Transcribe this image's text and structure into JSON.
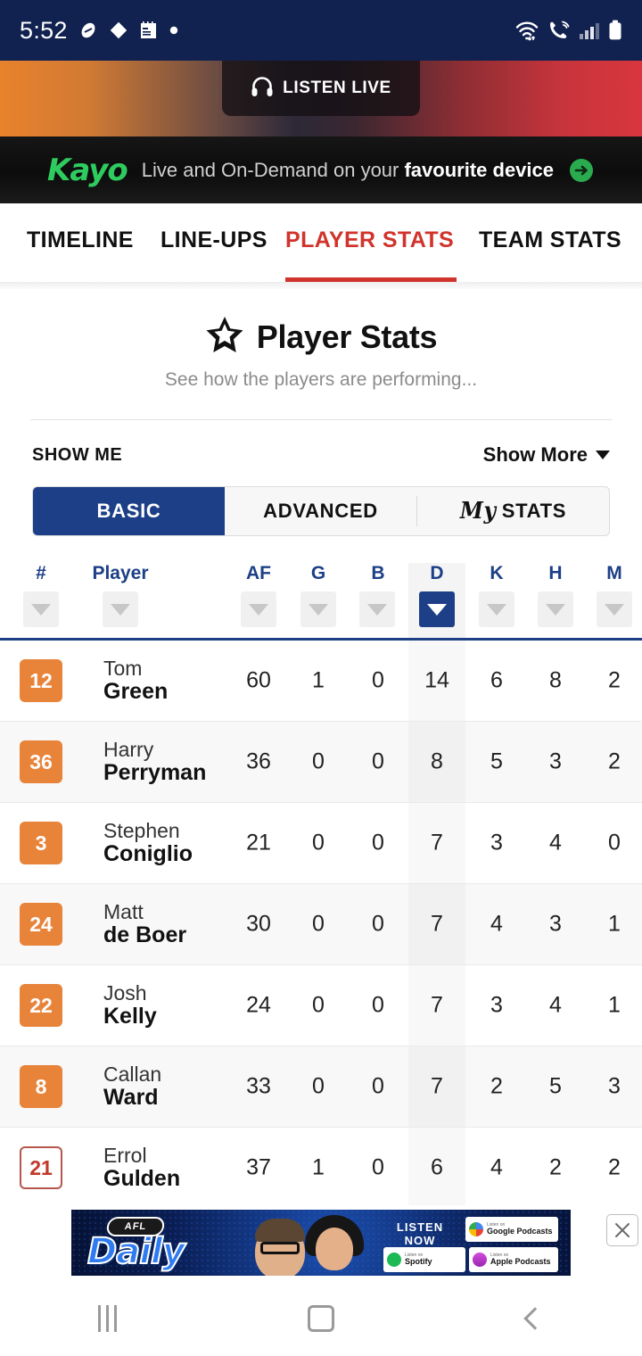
{
  "status_bar": {
    "time": "5:52",
    "left_icons": [
      "pill-icon",
      "diamond-icon",
      "calendar-icon",
      "dot-icon"
    ],
    "right_icons": [
      "wifi-icon",
      "call-icon",
      "signal-icon",
      "battery-icon"
    ]
  },
  "hero": {
    "listen_live_label": "LISTEN LIVE",
    "icon": "headphones-icon",
    "gradient_left": "#e8822c",
    "gradient_mid": "#2c2838",
    "gradient_right": "#d8363e"
  },
  "promo": {
    "brand": "Kayo",
    "message_prefix": "Live and On-Demand on your ",
    "message_bold": "favourite device",
    "arrow_icon": "arrow-right-circle-icon",
    "brand_color": "#2ecc5f"
  },
  "nav_tabs": {
    "items": [
      {
        "label": "TIMELINE",
        "active": false
      },
      {
        "label": "LINE-UPS",
        "active": false
      },
      {
        "label": "PLAYER STATS",
        "active": true
      },
      {
        "label": "TEAM STATS",
        "active": false
      }
    ],
    "active_color": "#d0342c"
  },
  "page_header": {
    "star_icon": "star-icon",
    "title": "Player Stats",
    "subtitle": "See how the players are performing..."
  },
  "filters": {
    "show_me_label": "SHOW ME",
    "show_more_label": "Show More",
    "show_more_icon": "chevron-down-icon",
    "segments": [
      {
        "label": "BASIC",
        "active": true
      },
      {
        "label": "ADVANCED",
        "active": false
      },
      {
        "label": "STATS",
        "prefix": "My",
        "active": false
      }
    ],
    "active_segment_color": "#1c3f87"
  },
  "table": {
    "columns": [
      {
        "key": "num",
        "label": "#",
        "sorted": false
      },
      {
        "key": "player",
        "label": "Player",
        "sorted": false
      },
      {
        "key": "af",
        "label": "AF",
        "sorted": false
      },
      {
        "key": "g",
        "label": "G",
        "sorted": false
      },
      {
        "key": "b",
        "label": "B",
        "sorted": false
      },
      {
        "key": "d",
        "label": "D",
        "sorted": true
      },
      {
        "key": "k",
        "label": "K",
        "sorted": false
      },
      {
        "key": "h",
        "label": "H",
        "sorted": false
      },
      {
        "key": "m",
        "label": "M",
        "sorted": false
      }
    ],
    "sort_icon": "sort-descending-triangle-icon",
    "header_color": "#1c3f87",
    "rows": [
      {
        "num": "12",
        "first": "Tom",
        "last": "Green",
        "af": "60",
        "g": "1",
        "b": "0",
        "d": "14",
        "k": "6",
        "h": "8",
        "m": "2",
        "badge_style": "filled"
      },
      {
        "num": "36",
        "first": "Harry",
        "last": "Perryman",
        "af": "36",
        "g": "0",
        "b": "0",
        "d": "8",
        "k": "5",
        "h": "3",
        "m": "2",
        "badge_style": "filled"
      },
      {
        "num": "3",
        "first": "Stephen",
        "last": "Coniglio",
        "af": "21",
        "g": "0",
        "b": "0",
        "d": "7",
        "k": "3",
        "h": "4",
        "m": "0",
        "badge_style": "filled"
      },
      {
        "num": "24",
        "first": "Matt",
        "last": "de Boer",
        "af": "30",
        "g": "0",
        "b": "0",
        "d": "7",
        "k": "4",
        "h": "3",
        "m": "1",
        "badge_style": "filled"
      },
      {
        "num": "22",
        "first": "Josh",
        "last": "Kelly",
        "af": "24",
        "g": "0",
        "b": "0",
        "d": "7",
        "k": "3",
        "h": "4",
        "m": "1",
        "badge_style": "filled"
      },
      {
        "num": "8",
        "first": "Callan",
        "last": "Ward",
        "af": "33",
        "g": "0",
        "b": "0",
        "d": "7",
        "k": "2",
        "h": "5",
        "m": "3",
        "badge_style": "filled"
      },
      {
        "num": "21",
        "first": "Errol",
        "last": "Gulden",
        "af": "37",
        "g": "1",
        "b": "0",
        "d": "6",
        "k": "4",
        "h": "2",
        "m": "2",
        "badge_style": "outline"
      }
    ],
    "badge_fill_color": "#e8833a",
    "badge_outline_color": "#b5574c"
  },
  "ad": {
    "brand_tag": "AFL",
    "title": "Daily",
    "listen_now_label": "LISTEN NOW",
    "chips": [
      {
        "small": "Listen on",
        "name": "Google Podcasts"
      },
      {
        "small": "Listen on",
        "name": "Spotify"
      },
      {
        "small": "Listen on",
        "name": "Apple Podcasts"
      }
    ],
    "close_icon": "close-icon"
  },
  "android_nav": {
    "recents_icon": "recents-icon",
    "home_icon": "home-icon",
    "back_icon": "back-icon"
  }
}
